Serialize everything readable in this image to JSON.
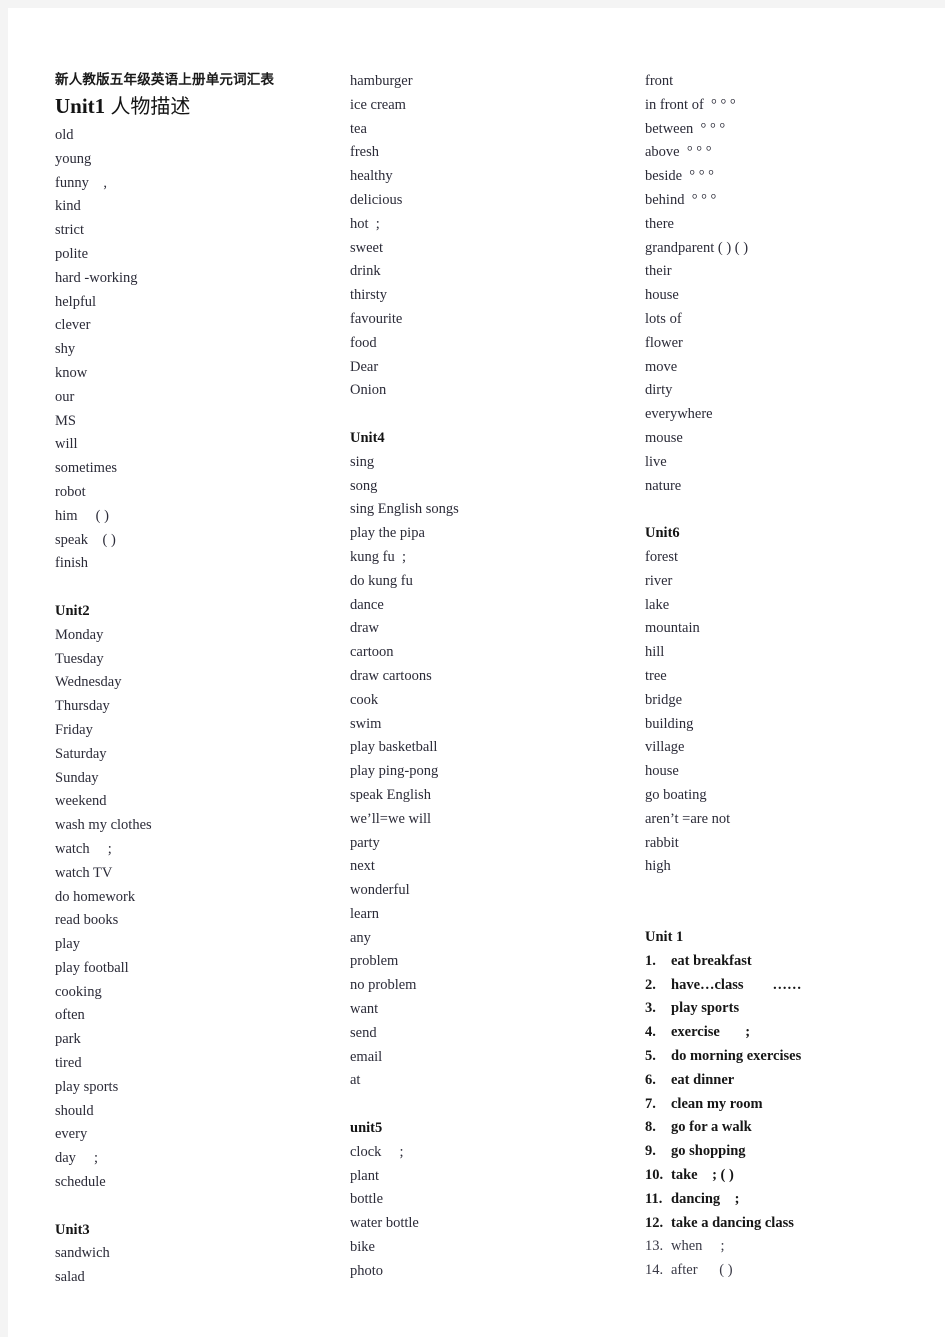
{
  "document": {
    "title": "新人教版五年级英语上册单元词汇表",
    "main_heading_en": "Unit1",
    "main_heading_cn": "人物描述"
  },
  "columns": {
    "column1": [
      {
        "type": "word",
        "text": "old"
      },
      {
        "type": "word",
        "text": "young"
      },
      {
        "type": "word",
        "text": "funny    ,"
      },
      {
        "type": "word",
        "text": "kind"
      },
      {
        "type": "word",
        "text": "strict"
      },
      {
        "type": "word",
        "text": "polite"
      },
      {
        "type": "word",
        "text": "hard -working"
      },
      {
        "type": "word",
        "text": "helpful"
      },
      {
        "type": "word",
        "text": "clever"
      },
      {
        "type": "word",
        "text": "shy"
      },
      {
        "type": "word",
        "text": "know"
      },
      {
        "type": "word",
        "text": "our"
      },
      {
        "type": "word",
        "text": "MS"
      },
      {
        "type": "word",
        "text": "will"
      },
      {
        "type": "word",
        "text": "sometimes"
      },
      {
        "type": "word",
        "text": "robot"
      },
      {
        "type": "word",
        "text": "him     ( )"
      },
      {
        "type": "word",
        "text": "speak    ( )"
      },
      {
        "type": "word",
        "text": "finish"
      },
      {
        "type": "gap"
      },
      {
        "type": "head",
        "text": "Unit2"
      },
      {
        "type": "word",
        "text": "Monday"
      },
      {
        "type": "word",
        "text": "Tuesday"
      },
      {
        "type": "word",
        "text": "Wednesday"
      },
      {
        "type": "word",
        "text": "Thursday"
      },
      {
        "type": "word",
        "text": "Friday"
      },
      {
        "type": "word",
        "text": "Saturday"
      },
      {
        "type": "word",
        "text": "Sunday"
      },
      {
        "type": "word",
        "text": "weekend"
      },
      {
        "type": "word",
        "text": "wash my clothes"
      },
      {
        "type": "word",
        "text": "watch     ;"
      },
      {
        "type": "word",
        "text": "watch TV"
      },
      {
        "type": "word",
        "text": "do homework"
      },
      {
        "type": "word",
        "text": "read books"
      },
      {
        "type": "word",
        "text": "play"
      },
      {
        "type": "word",
        "text": "play football"
      },
      {
        "type": "word",
        "text": "cooking"
      },
      {
        "type": "word",
        "text": "often"
      },
      {
        "type": "word",
        "text": "park"
      },
      {
        "type": "word",
        "text": "tired"
      },
      {
        "type": "word",
        "text": "play sports"
      },
      {
        "type": "word",
        "text": "should"
      },
      {
        "type": "word",
        "text": "every"
      },
      {
        "type": "word",
        "text": "day     ;"
      },
      {
        "type": "word",
        "text": "schedule"
      },
      {
        "type": "gap"
      },
      {
        "type": "head",
        "text": "Unit3"
      },
      {
        "type": "word",
        "text": "sandwich"
      },
      {
        "type": "word",
        "text": "salad"
      }
    ],
    "column2": [
      {
        "type": "word",
        "text": "hamburger"
      },
      {
        "type": "word",
        "text": "ice cream"
      },
      {
        "type": "word",
        "text": "tea"
      },
      {
        "type": "word",
        "text": "fresh"
      },
      {
        "type": "word",
        "text": "healthy"
      },
      {
        "type": "word",
        "text": "delicious"
      },
      {
        "type": "word",
        "text": "hot  ;"
      },
      {
        "type": "word",
        "text": "sweet"
      },
      {
        "type": "word",
        "text": "drink"
      },
      {
        "type": "word",
        "text": "thirsty"
      },
      {
        "type": "word",
        "text": "favourite"
      },
      {
        "type": "word",
        "text": "food"
      },
      {
        "type": "word",
        "text": "Dear"
      },
      {
        "type": "word",
        "text": "Onion"
      },
      {
        "type": "gap"
      },
      {
        "type": "head",
        "text": "Unit4"
      },
      {
        "type": "word",
        "text": "sing"
      },
      {
        "type": "word",
        "text": "song"
      },
      {
        "type": "word",
        "text": "sing English songs"
      },
      {
        "type": "word",
        "text": "play the pipa"
      },
      {
        "type": "word",
        "text": "kung fu  ;"
      },
      {
        "type": "word",
        "text": "do kung fu"
      },
      {
        "type": "word",
        "text": "dance"
      },
      {
        "type": "word",
        "text": "draw"
      },
      {
        "type": "word",
        "text": "cartoon"
      },
      {
        "type": "word",
        "text": "draw cartoons"
      },
      {
        "type": "word",
        "text": "cook"
      },
      {
        "type": "word",
        "text": "swim"
      },
      {
        "type": "word",
        "text": "play basketball"
      },
      {
        "type": "word",
        "text": "play ping-pong"
      },
      {
        "type": "word",
        "text": "speak English"
      },
      {
        "type": "word",
        "text": "we’ll=we will"
      },
      {
        "type": "word",
        "text": "party"
      },
      {
        "type": "word",
        "text": "next"
      },
      {
        "type": "word",
        "text": "wonderful"
      },
      {
        "type": "word",
        "text": "learn"
      },
      {
        "type": "word",
        "text": "any"
      },
      {
        "type": "word",
        "text": "problem"
      },
      {
        "type": "word",
        "text": "no problem"
      },
      {
        "type": "word",
        "text": "want"
      },
      {
        "type": "word",
        "text": "send"
      },
      {
        "type": "word",
        "text": "email"
      },
      {
        "type": "word",
        "text": "at"
      },
      {
        "type": "gap"
      },
      {
        "type": "head",
        "text": "unit5"
      },
      {
        "type": "word",
        "text": "clock     ;"
      },
      {
        "type": "word",
        "text": "plant"
      },
      {
        "type": "word",
        "text": "bottle"
      },
      {
        "type": "word",
        "text": "water bottle"
      },
      {
        "type": "word",
        "text": "bike"
      },
      {
        "type": "word",
        "text": "photo"
      }
    ],
    "column3": [
      {
        "type": "word",
        "text": "front"
      },
      {
        "type": "word",
        "text": "in front of  ° ° °"
      },
      {
        "type": "word",
        "text": "between  ° ° °"
      },
      {
        "type": "word",
        "text": "above  ° ° °"
      },
      {
        "type": "word",
        "text": "beside  ° ° °"
      },
      {
        "type": "word",
        "text": "behind  ° ° °"
      },
      {
        "type": "word",
        "text": "there"
      },
      {
        "type": "word",
        "text": "grandparent ( ) ( )"
      },
      {
        "type": "word",
        "text": "their"
      },
      {
        "type": "word",
        "text": "house"
      },
      {
        "type": "word",
        "text": "lots of"
      },
      {
        "type": "word",
        "text": "flower"
      },
      {
        "type": "word",
        "text": "move"
      },
      {
        "type": "word",
        "text": "dirty"
      },
      {
        "type": "word",
        "text": "everywhere"
      },
      {
        "type": "word",
        "text": "mouse"
      },
      {
        "type": "word",
        "text": "live"
      },
      {
        "type": "word",
        "text": "nature"
      },
      {
        "type": "gap"
      },
      {
        "type": "head",
        "text": "Unit6"
      },
      {
        "type": "word",
        "text": "forest"
      },
      {
        "type": "word",
        "text": "river"
      },
      {
        "type": "word",
        "text": "lake"
      },
      {
        "type": "word",
        "text": "mountain"
      },
      {
        "type": "word",
        "text": "hill"
      },
      {
        "type": "word",
        "text": "tree"
      },
      {
        "type": "word",
        "text": "bridge"
      },
      {
        "type": "word",
        "text": "building"
      },
      {
        "type": "word",
        "text": "village"
      },
      {
        "type": "word",
        "text": "house"
      },
      {
        "type": "word",
        "text": "go boating"
      },
      {
        "type": "word",
        "text": "aren’t =are not"
      },
      {
        "type": "word",
        "text": "rabbit"
      },
      {
        "type": "word",
        "text": "high"
      }
    ]
  },
  "phrase_list": {
    "heading": "Unit 1",
    "items": [
      {
        "num": "1.",
        "text": "eat breakfast",
        "bold": true
      },
      {
        "num": "2.",
        "text": "have…class        ……",
        "bold": true
      },
      {
        "num": "3.",
        "text": "play sports",
        "bold": true
      },
      {
        "num": "4.",
        "text": "exercise       ;",
        "bold": true
      },
      {
        "num": "5.",
        "text": "do morning exercises",
        "bold": true
      },
      {
        "num": "6.",
        "text": "eat dinner",
        "bold": true
      },
      {
        "num": "7.",
        "text": "clean my room",
        "bold": true
      },
      {
        "num": "8.",
        "text": "go for a walk",
        "bold": true
      },
      {
        "num": "9.",
        "text": "go shopping",
        "bold": true
      },
      {
        "num": "10.",
        "text": "take    ; ( )",
        "bold": true
      },
      {
        "num": "11.",
        "text": "dancing    ;",
        "bold": true
      },
      {
        "num": "12.",
        "text": "take a dancing class",
        "bold": true
      },
      {
        "num": "13.",
        "text": "when     ;",
        "bold": false
      },
      {
        "num": "14.",
        "text": "after      ( )",
        "bold": false
      }
    ]
  }
}
